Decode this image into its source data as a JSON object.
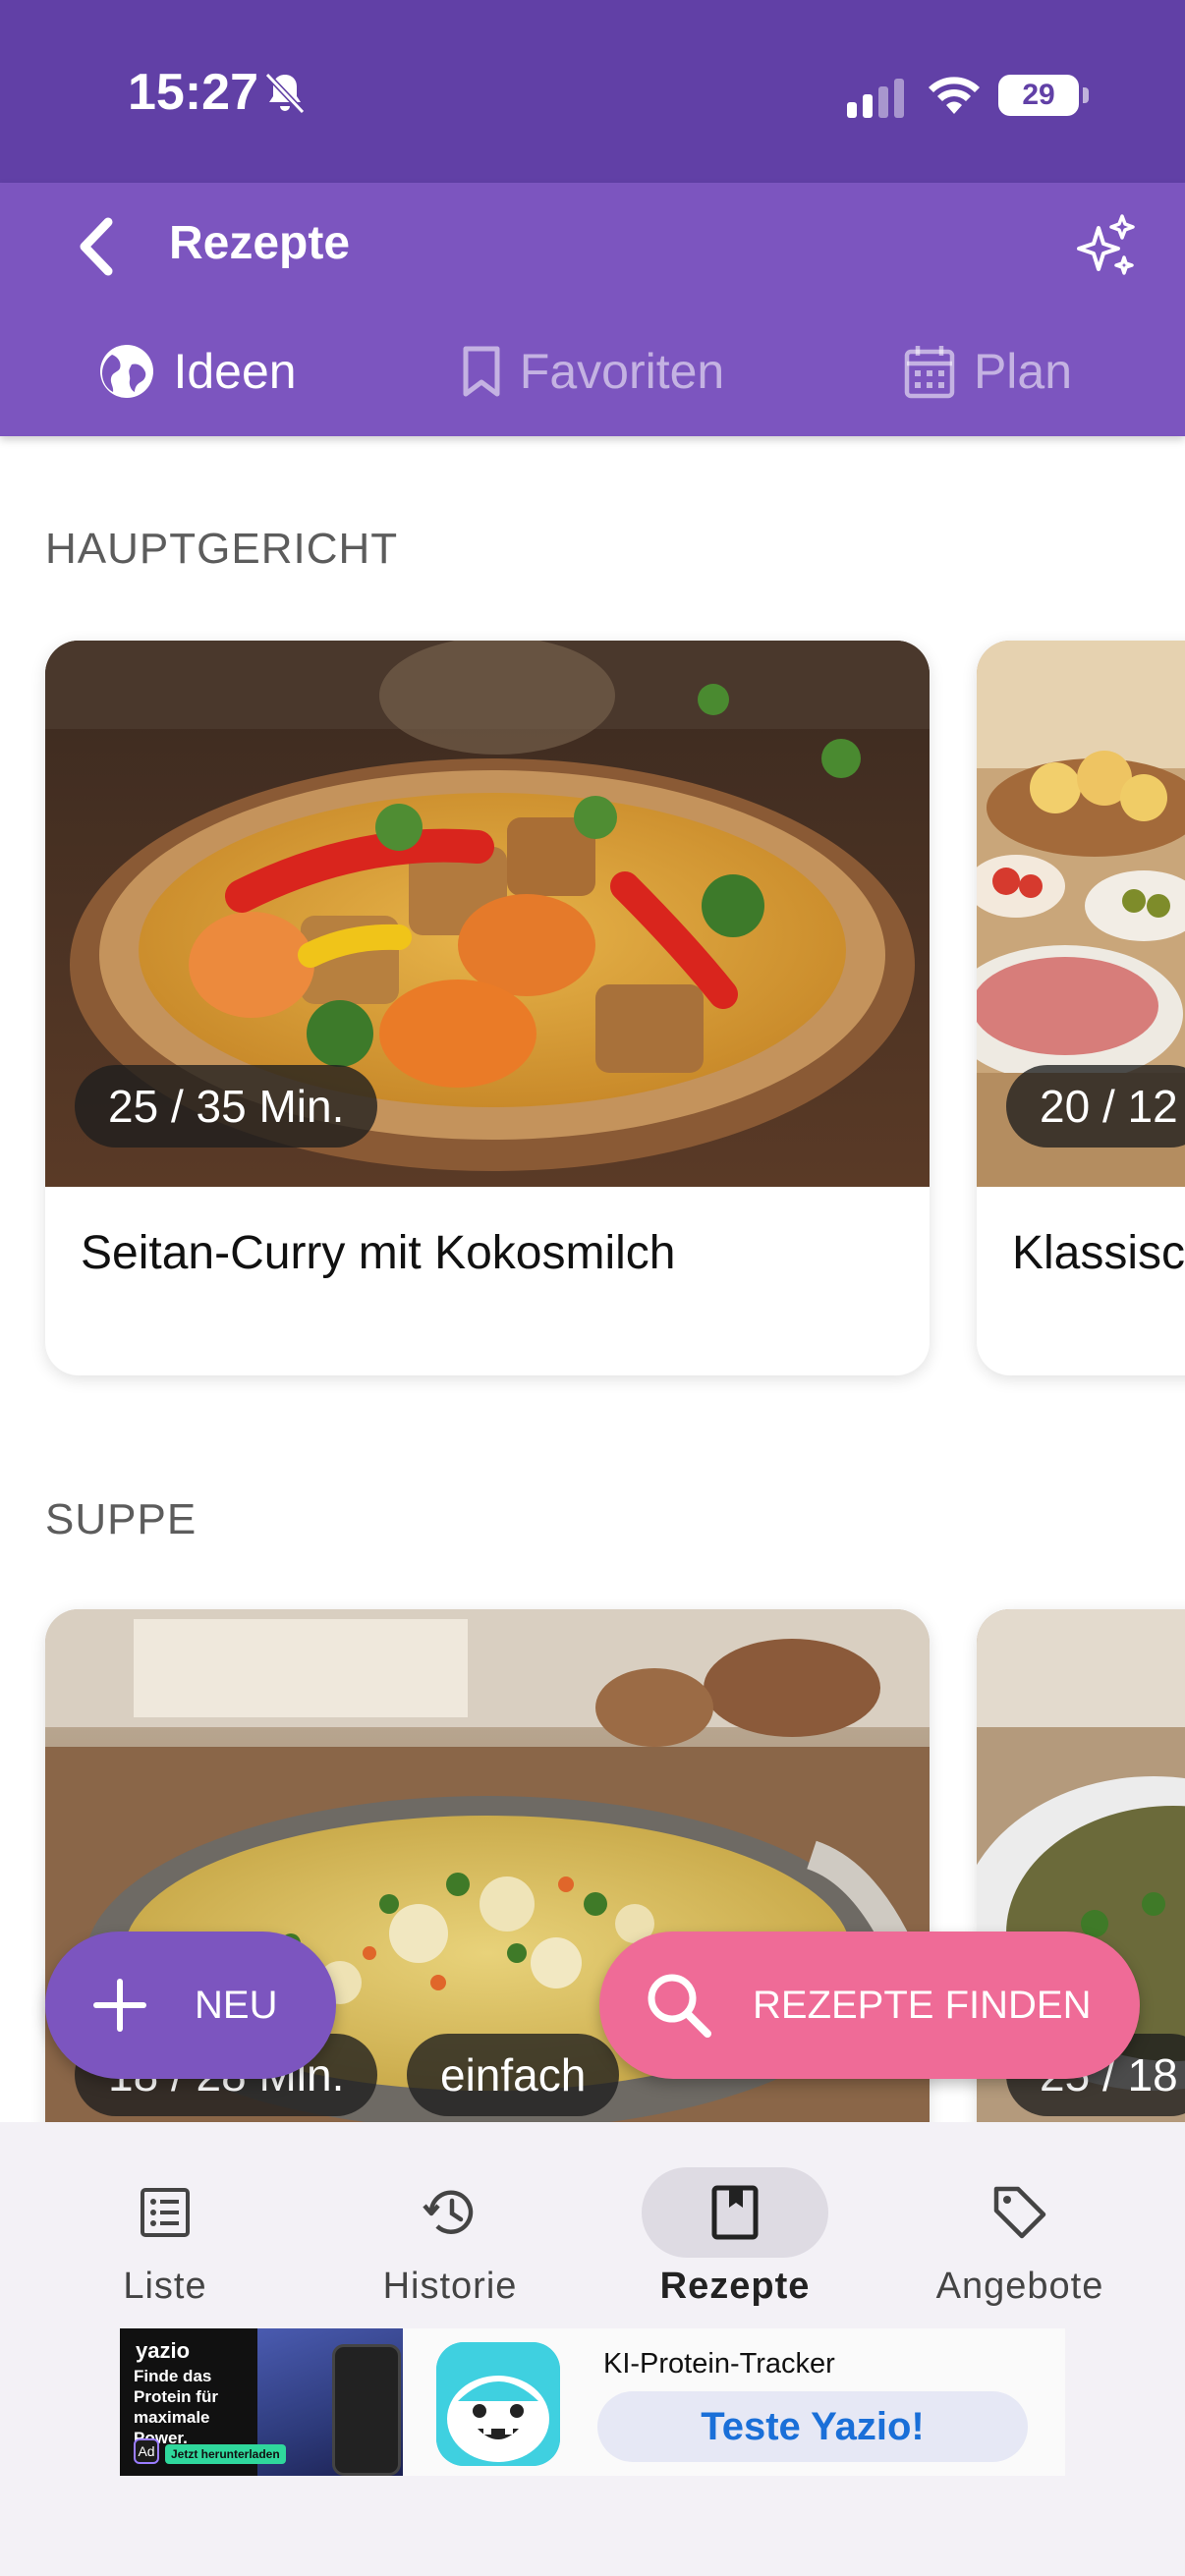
{
  "status_bar": {
    "time": "15:27",
    "battery": "29"
  },
  "app_bar": {
    "title": "Rezepte"
  },
  "tabs": [
    {
      "label": "Ideen",
      "icon": "globe-icon",
      "active": true
    },
    {
      "label": "Favoriten",
      "icon": "bookmark-icon",
      "active": false
    },
    {
      "label": "Plan",
      "icon": "calendar-icon",
      "active": false
    }
  ],
  "sections": [
    {
      "title": "HAUPTGERICHT",
      "cards": [
        {
          "time": "25 / 35 Min.",
          "name": "Seitan-Curry mit Kokosmilch"
        },
        {
          "time": "20 / 12",
          "name": "Klassisc"
        }
      ]
    },
    {
      "title": "SUPPE",
      "cards": [
        {
          "time": "18 / 28 Min.",
          "difficulty": "einfach"
        },
        {
          "time": "25 / 18"
        }
      ]
    }
  ],
  "fabs": {
    "new_label": "NEU",
    "find_label": "REZEPTE FINDEN"
  },
  "bottom_nav": [
    {
      "label": "Liste",
      "icon": "list-icon",
      "active": false
    },
    {
      "label": "Historie",
      "icon": "history-icon",
      "active": false
    },
    {
      "label": "Rezepte",
      "icon": "book-icon",
      "active": true
    },
    {
      "label": "Angebote",
      "icon": "tag-icon",
      "active": false
    }
  ],
  "ad": {
    "brand": "yazio",
    "tagline": "Finde das Protein für maximale Power.",
    "download": "Jetzt herunterladen",
    "badge": "Ad",
    "title": "KI-Protein-Tracker",
    "cta": "Teste Yazio!"
  },
  "colors": {
    "status_bar": "#6140a6",
    "app_bar": "#7c55bf",
    "find_button": "#ef6b97",
    "cta_text": "#1a6fd8"
  }
}
